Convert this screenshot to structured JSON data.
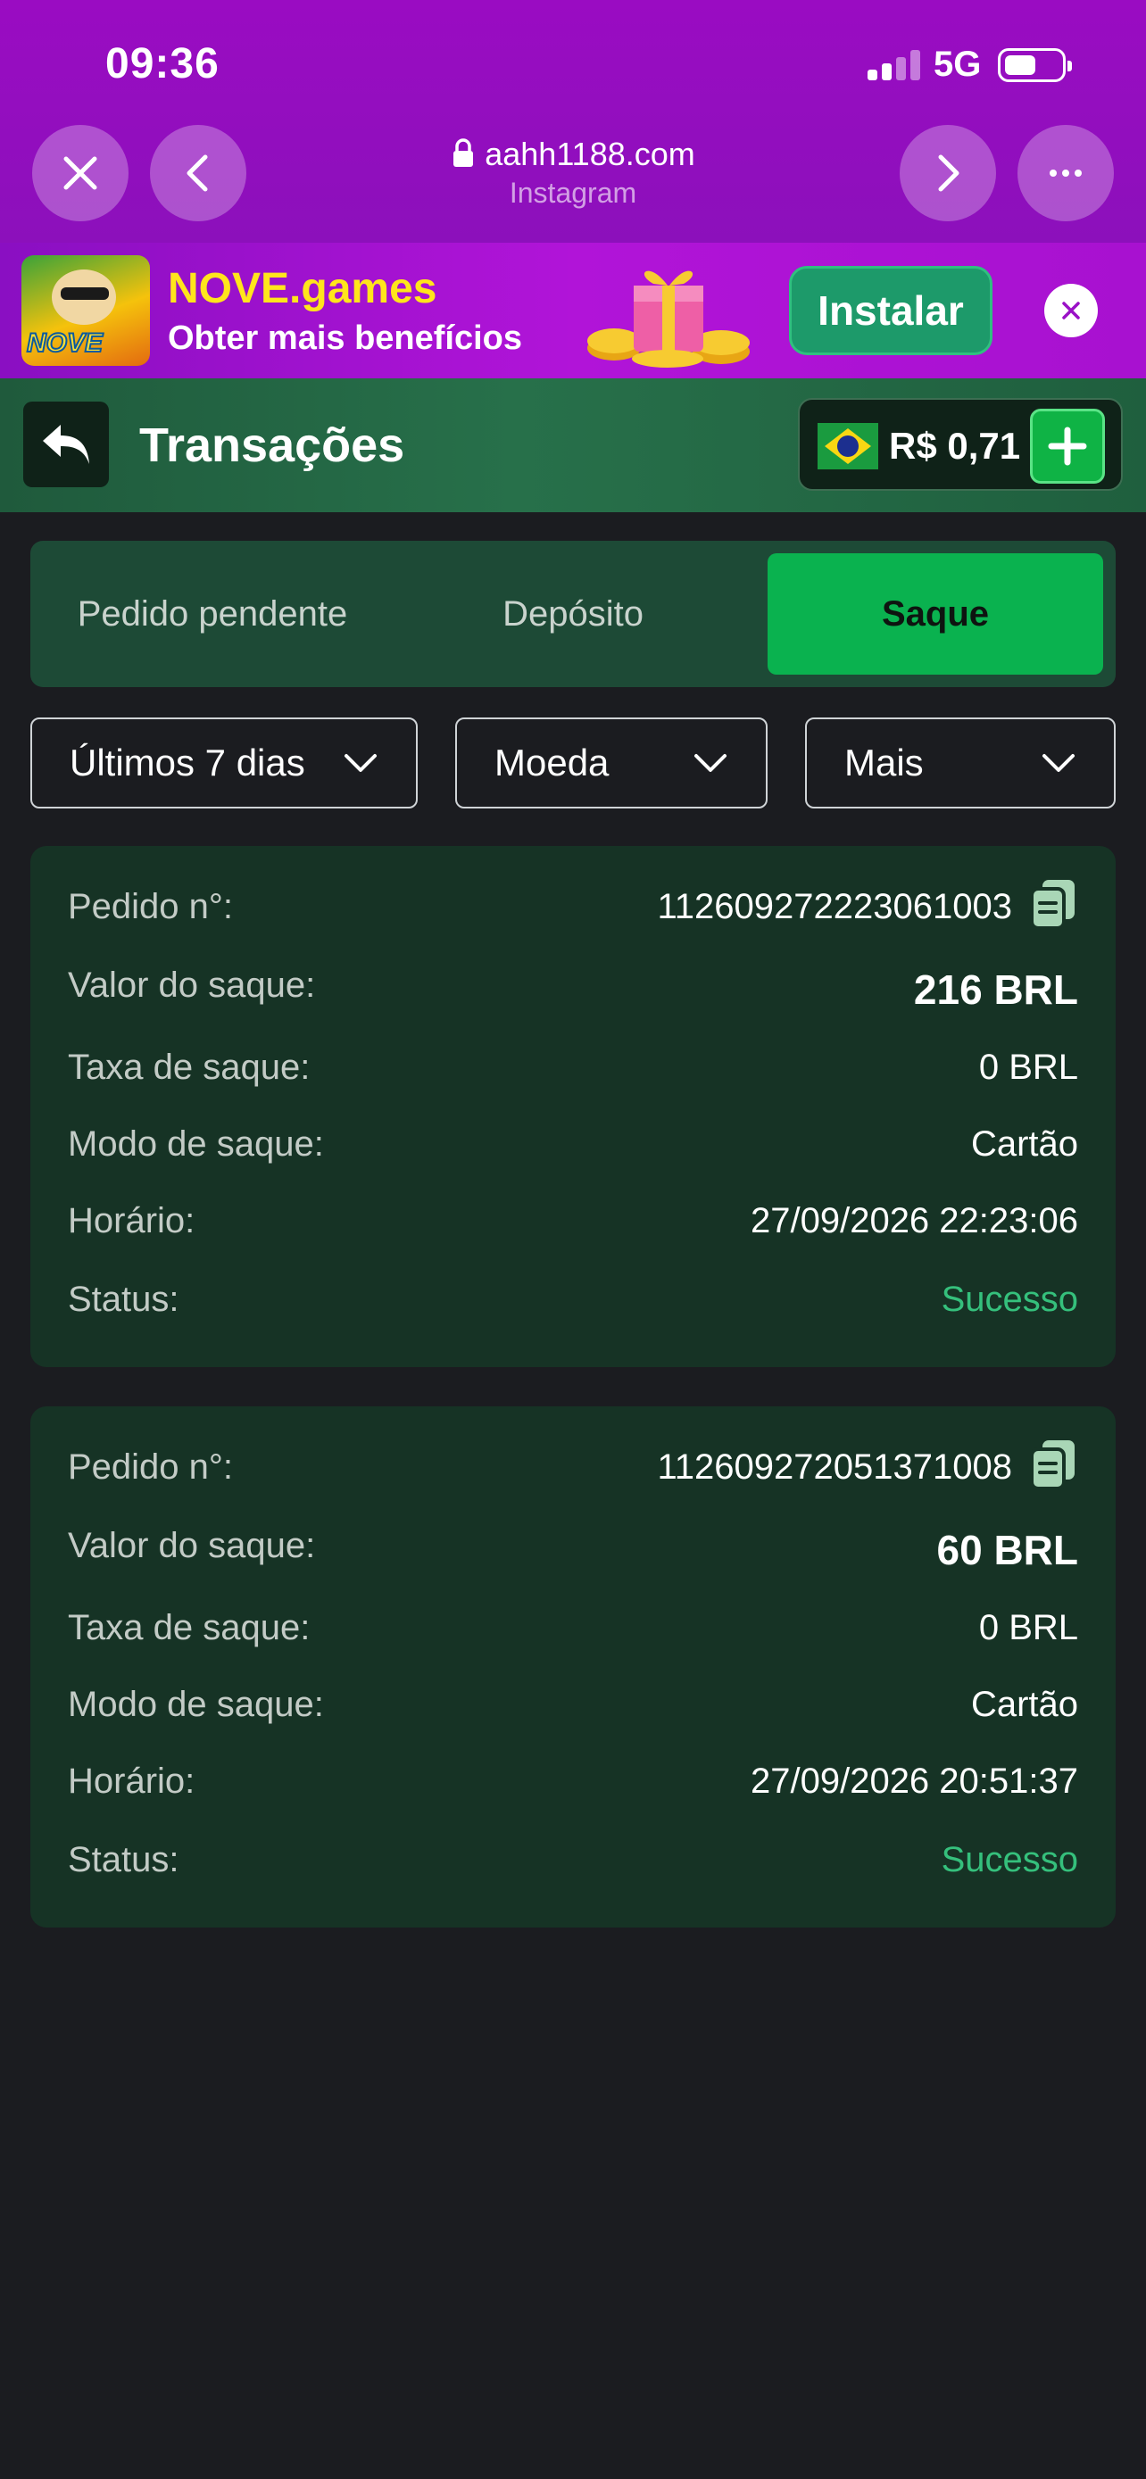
{
  "status_bar": {
    "time": "09:36",
    "network": "5G"
  },
  "browser": {
    "url": "aahh1188.com",
    "source": "Instagram"
  },
  "banner": {
    "title": "NOVE.games",
    "subtitle": "Obter mais benefícios",
    "install_label": "Instalar",
    "app_logo_text": "NOVE"
  },
  "header": {
    "title": "Transações",
    "balance": "R$ 0,71"
  },
  "tabs": [
    {
      "label": "Pedido pendente",
      "active": false
    },
    {
      "label": "Depósito",
      "active": false
    },
    {
      "label": "Saque",
      "active": true
    }
  ],
  "filters": [
    {
      "label": "Últimos 7 dias"
    },
    {
      "label": "Moeda"
    },
    {
      "label": "Mais"
    }
  ],
  "transactions": [
    {
      "order_label": "Pedido n°:",
      "order_id": "112609272223061003",
      "amount_label": "Valor do saque:",
      "amount": "216 BRL",
      "fee_label": "Taxa de saque:",
      "fee": "0 BRL",
      "mode_label": "Modo de saque:",
      "mode": "Cartão",
      "time_label": "Horário:",
      "time": "27/09/2026 22:23:06",
      "status_label": "Status:",
      "status": "Sucesso"
    },
    {
      "order_label": "Pedido n°:",
      "order_id": "112609272051371008",
      "amount_label": "Valor do saque:",
      "amount": "60 BRL",
      "fee_label": "Taxa de saque:",
      "fee": "0 BRL",
      "mode_label": "Modo de saque:",
      "mode": "Cartão",
      "time_label": "Horário:",
      "time": "27/09/2026 20:51:37",
      "status_label": "Status:",
      "status": "Sucesso"
    }
  ],
  "colors": {
    "chrome": "#9a0cc2",
    "accent_green": "#0ab24f",
    "success": "#35c07c",
    "card_bg": "#163325"
  }
}
